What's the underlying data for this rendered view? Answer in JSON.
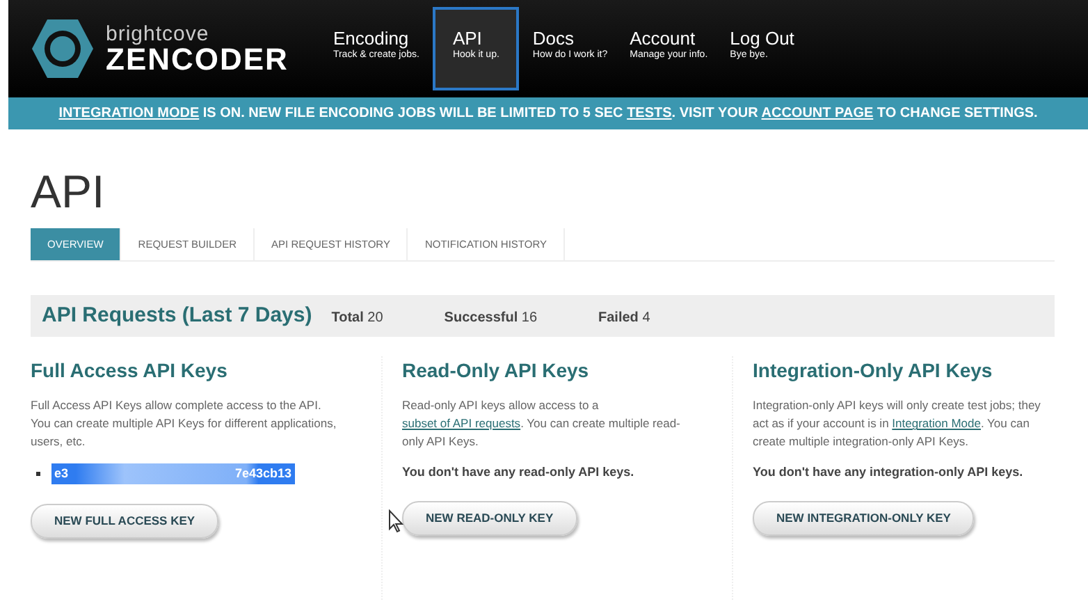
{
  "header": {
    "logo": {
      "top": "brightcove",
      "bottom": "ZENCODER"
    },
    "nav": [
      {
        "label": "Encoding",
        "sub": "Track & create jobs.",
        "selected": false
      },
      {
        "label": "API",
        "sub": "Hook it up.",
        "selected": true
      },
      {
        "label": "Docs",
        "sub": "How do I work it?",
        "selected": false
      },
      {
        "label": "Account",
        "sub": "Manage your info.",
        "selected": false
      },
      {
        "label": "Log Out",
        "sub": "Bye bye.",
        "selected": false
      }
    ]
  },
  "banner": [
    {
      "text": "INTEGRATION MODE",
      "link": true
    },
    {
      "text": " IS ON. NEW FILE ENCODING JOBS WILL BE LIMITED TO 5 SEC ",
      "link": false
    },
    {
      "text": "TESTS",
      "link": true
    },
    {
      "text": ". VISIT YOUR ",
      "link": false
    },
    {
      "text": "ACCOUNT PAGE",
      "link": true
    },
    {
      "text": " TO CHANGE SETTINGS.",
      "link": false
    }
  ],
  "page_title": "API",
  "tabs": [
    {
      "label": "OVERVIEW",
      "selected": true
    },
    {
      "label": "REQUEST BUILDER",
      "selected": false
    },
    {
      "label": "API REQUEST HISTORY",
      "selected": false
    },
    {
      "label": "NOTIFICATION HISTORY",
      "selected": false
    }
  ],
  "requests": {
    "title": "API Requests (Last 7 Days)",
    "stats": [
      {
        "label": "Total",
        "value": "20"
      },
      {
        "label": "Successful",
        "value": "16"
      },
      {
        "label": "Failed",
        "value": "4"
      }
    ]
  },
  "columns": [
    {
      "title": "Full Access API Keys",
      "description": [
        {
          "text": "Full Access API Keys allow complete access to the API. You can create multiple API Keys for different applications, users, etc.",
          "link": false
        }
      ],
      "keys": [
        {
          "start": "e3",
          "end": "7e43cb13",
          "selected": true
        }
      ],
      "button": "NEW FULL ACCESS KEY"
    },
    {
      "title": "Read-Only API Keys",
      "description": [
        {
          "text": "Read-only API keys allow access to a ",
          "link": false
        },
        {
          "text": "subset of API requests",
          "link": true
        },
        {
          "text": ". You can create multiple read-only API Keys.",
          "link": false
        }
      ],
      "empty_note": "You don't have any read-only API keys.",
      "button": "NEW READ-ONLY KEY"
    },
    {
      "title": "Integration-Only API Keys",
      "description": [
        {
          "text": "Integration-only API keys will only create test jobs; they act as if your account is in ",
          "link": false
        },
        {
          "text": "Integration Mode",
          "link": true
        },
        {
          "text": ". You can create multiple integration-only API Keys.",
          "link": false
        }
      ],
      "empty_note": "You don't have any integration-only API keys.",
      "button": "NEW INTEGRATION-ONLY KEY"
    }
  ]
}
